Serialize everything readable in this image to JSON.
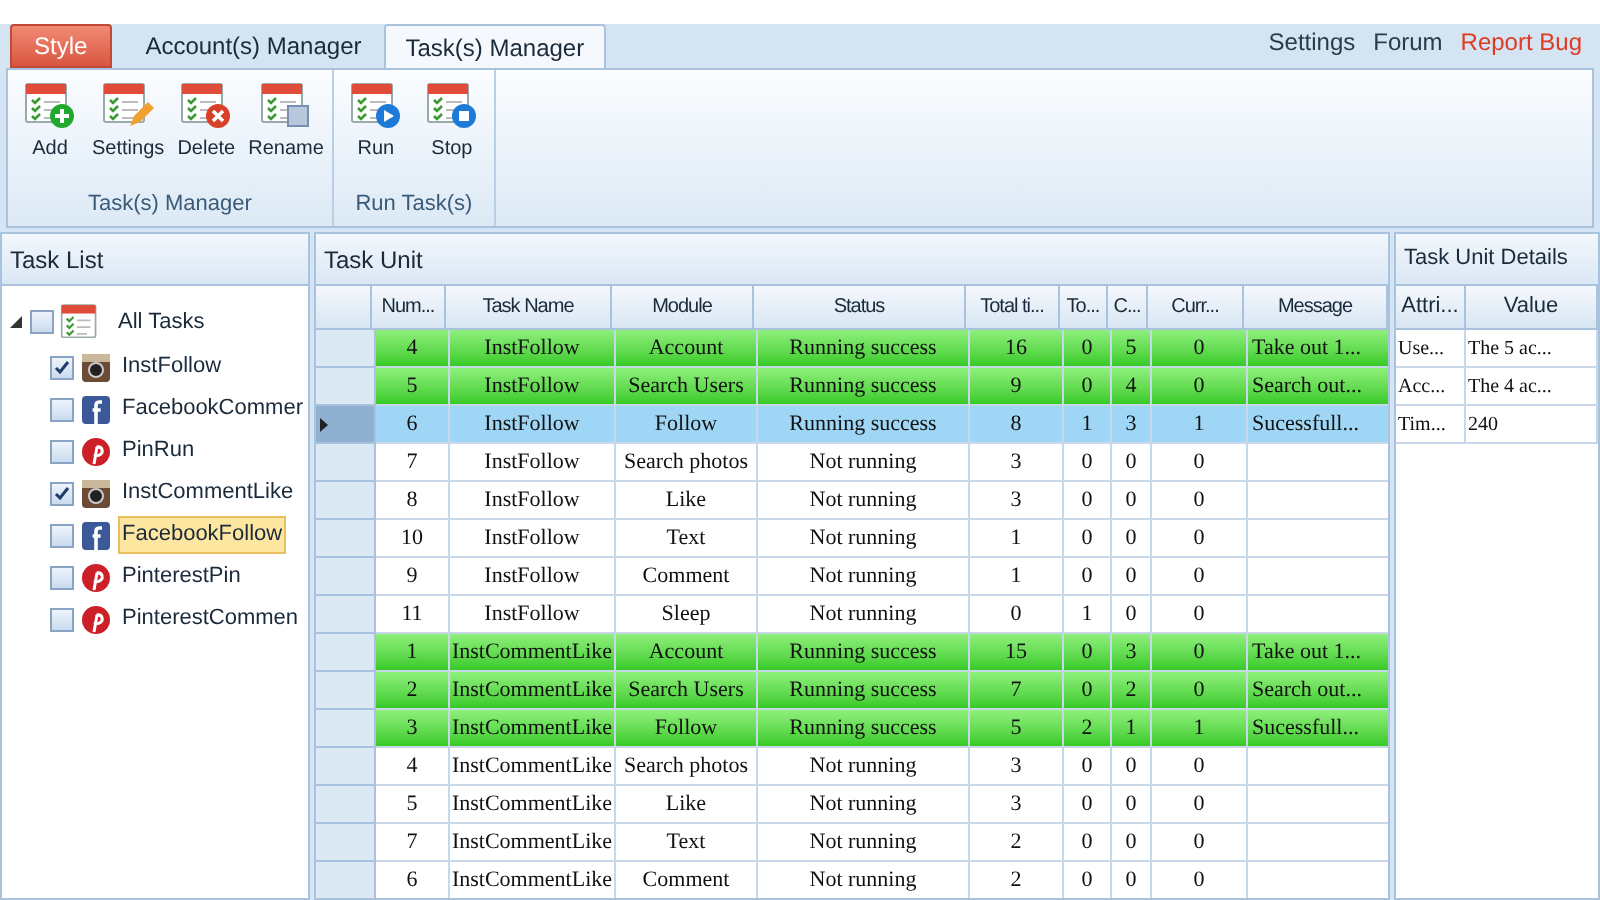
{
  "tabs": [
    {
      "label": "Style",
      "kind": "menu",
      "selected": false
    },
    {
      "label": "Account(s) Manager",
      "kind": "tab",
      "selected": false
    },
    {
      "label": "Task(s) Manager",
      "kind": "tab",
      "selected": true
    }
  ],
  "links": [
    {
      "label": "Settings",
      "highlight": false
    },
    {
      "label": "Forum",
      "highlight": false
    },
    {
      "label": "Report Bug",
      "highlight": true
    }
  ],
  "ribbon_groups": [
    {
      "label": "Task(s) Manager",
      "buttons": [
        {
          "label": "Add",
          "kind": "add"
        },
        {
          "label": "Settings",
          "kind": "edit"
        },
        {
          "label": "Delete",
          "kind": "delete"
        },
        {
          "label": "Rename",
          "kind": "rename"
        }
      ]
    },
    {
      "label": "Run Task(s)",
      "buttons": [
        {
          "label": "Run",
          "kind": "run"
        },
        {
          "label": "Stop",
          "kind": "stop"
        }
      ]
    }
  ],
  "task_list": {
    "title": "Task List",
    "root": {
      "label": "All Tasks",
      "checked": false,
      "expanded": true,
      "selected": false,
      "children": [
        {
          "label": "InstFollow",
          "kind": "instagram",
          "checked": true,
          "selected": false
        },
        {
          "label": "FacebookCommer",
          "kind": "facebook",
          "checked": false,
          "selected": false
        },
        {
          "label": "PinRun",
          "kind": "pinterest",
          "checked": false,
          "selected": false
        },
        {
          "label": "InstCommentLike",
          "kind": "instagram",
          "checked": true,
          "selected": false
        },
        {
          "label": "FacebookFollow",
          "kind": "facebook",
          "checked": false,
          "selected": true
        },
        {
          "label": "PinterestPin",
          "kind": "pinterest",
          "checked": false,
          "selected": false
        },
        {
          "label": "PinterestCommen",
          "kind": "pinterest",
          "checked": false,
          "selected": false
        }
      ]
    }
  },
  "task_unit": {
    "title": "Task Unit",
    "columns": [
      "Num...",
      "Task Name",
      "Module",
      "Status",
      "Total ti...",
      "To...",
      "C...",
      "Curr...",
      "Message"
    ],
    "rows": [
      {
        "kind": "success",
        "selected": false,
        "cells": [
          "4",
          "InstFollow",
          "Account",
          "Running success",
          "16",
          "0",
          "5",
          "0",
          "Take out 1..."
        ]
      },
      {
        "kind": "success",
        "selected": false,
        "cells": [
          "5",
          "InstFollow",
          "Search Users",
          "Running success",
          "9",
          "0",
          "4",
          "0",
          "Search out..."
        ]
      },
      {
        "kind": "success",
        "selected": true,
        "cells": [
          "6",
          "InstFollow",
          "Follow",
          "Running success",
          "8",
          "1",
          "3",
          "1",
          "Sucessfull..."
        ]
      },
      {
        "kind": "idle",
        "selected": false,
        "cells": [
          "7",
          "InstFollow",
          "Search photos",
          "Not running",
          "3",
          "0",
          "0",
          "0",
          ""
        ]
      },
      {
        "kind": "idle",
        "selected": false,
        "cells": [
          "8",
          "InstFollow",
          "Like",
          "Not running",
          "3",
          "0",
          "0",
          "0",
          ""
        ]
      },
      {
        "kind": "idle",
        "selected": false,
        "cells": [
          "10",
          "InstFollow",
          "Text",
          "Not running",
          "1",
          "0",
          "0",
          "0",
          ""
        ]
      },
      {
        "kind": "idle",
        "selected": false,
        "cells": [
          "9",
          "InstFollow",
          "Comment",
          "Not running",
          "1",
          "0",
          "0",
          "0",
          ""
        ]
      },
      {
        "kind": "idle",
        "selected": false,
        "cells": [
          "11",
          "InstFollow",
          "Sleep",
          "Not running",
          "0",
          "1",
          "0",
          "0",
          ""
        ]
      },
      {
        "kind": "success",
        "selected": false,
        "cells": [
          "1",
          "InstCommentLike",
          "Account",
          "Running success",
          "15",
          "0",
          "3",
          "0",
          "Take out 1..."
        ]
      },
      {
        "kind": "success",
        "selected": false,
        "cells": [
          "2",
          "InstCommentLike",
          "Search Users",
          "Running success",
          "7",
          "0",
          "2",
          "0",
          "Search out..."
        ]
      },
      {
        "kind": "success",
        "selected": false,
        "cells": [
          "3",
          "InstCommentLike",
          "Follow",
          "Running success",
          "5",
          "2",
          "1",
          "1",
          "Sucessfull..."
        ]
      },
      {
        "kind": "idle",
        "selected": false,
        "cells": [
          "4",
          "InstCommentLike",
          "Search photos",
          "Not running",
          "3",
          "0",
          "0",
          "0",
          ""
        ]
      },
      {
        "kind": "idle",
        "selected": false,
        "cells": [
          "5",
          "InstCommentLike",
          "Like",
          "Not running",
          "3",
          "0",
          "0",
          "0",
          ""
        ]
      },
      {
        "kind": "idle",
        "selected": false,
        "cells": [
          "7",
          "InstCommentLike",
          "Text",
          "Not running",
          "2",
          "0",
          "0",
          "0",
          ""
        ]
      },
      {
        "kind": "idle",
        "selected": false,
        "cells": [
          "6",
          "InstCommentLike",
          "Comment",
          "Not running",
          "2",
          "0",
          "0",
          "0",
          ""
        ]
      }
    ]
  },
  "details": {
    "title": "Task Unit Details",
    "columns": [
      "Attri...",
      "Value"
    ],
    "rows": [
      [
        "Use...",
        "The 5 ac..."
      ],
      [
        "Acc...",
        "The 4 ac..."
      ],
      [
        "Tim...",
        "240"
      ]
    ]
  }
}
